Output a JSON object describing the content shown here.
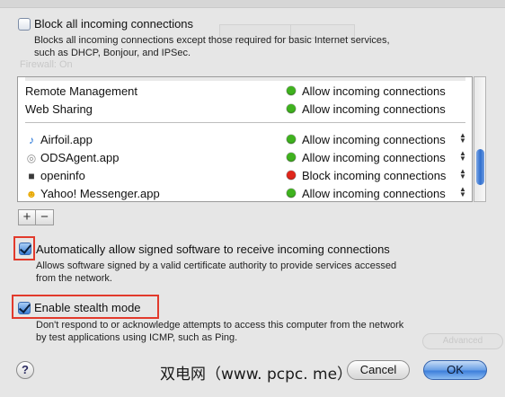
{
  "block_all": {
    "label": "Block all incoming connections",
    "desc_line1": "Blocks all incoming connections except those required for basic Internet services,",
    "desc_line2": "such as DHCP, Bonjour, and IPSec.",
    "checked": false
  },
  "services": [
    {
      "name": "Remote Management",
      "status": "Allow incoming connections",
      "status_color": "#3fb21e"
    },
    {
      "name": "Web Sharing",
      "status": "Allow incoming connections",
      "status_color": "#3fb21e"
    }
  ],
  "apps": [
    {
      "name": "Airfoil.app",
      "icon": "music-note-icon",
      "glyph": "♪",
      "icon_color": "#1b6fd6",
      "status": "Allow incoming connections",
      "status_color": "#3fb21e"
    },
    {
      "name": "ODSAgent.app",
      "icon": "disc-icon",
      "glyph": "◎",
      "icon_color": "#8a8a8a",
      "status": "Allow incoming connections",
      "status_color": "#3fb21e"
    },
    {
      "name": "openinfo",
      "icon": "terminal-icon",
      "glyph": "■",
      "icon_color": "#3a3a3a",
      "status": "Block incoming connections",
      "status_color": "#e0261b"
    },
    {
      "name": "Yahoo! Messenger.app",
      "icon": "smiley-icon",
      "glyph": "☻",
      "icon_color": "#e8a800",
      "status": "Allow incoming connections",
      "status_color": "#3fb21e"
    }
  ],
  "list_controls": {
    "add": "+",
    "remove": "−"
  },
  "auto_allow": {
    "label": "Automatically allow signed software to receive incoming connections",
    "desc_line1": "Allows software signed by a valid certificate authority to provide services accessed",
    "desc_line2": "from the network.",
    "checked": true
  },
  "stealth": {
    "label": "Enable stealth mode",
    "desc_line1": "Don't respond to or acknowledge attempts to access this computer from the network",
    "desc_line2": "by test applications using ICMP, such as Ping.",
    "checked": true
  },
  "footer": {
    "help": "?",
    "watermark": "双电网（www. pcpc. me）",
    "cancel": "Cancel",
    "ok": "OK"
  },
  "background": {
    "firewall_on": "Firewall: On",
    "advanced": "Advanced"
  }
}
